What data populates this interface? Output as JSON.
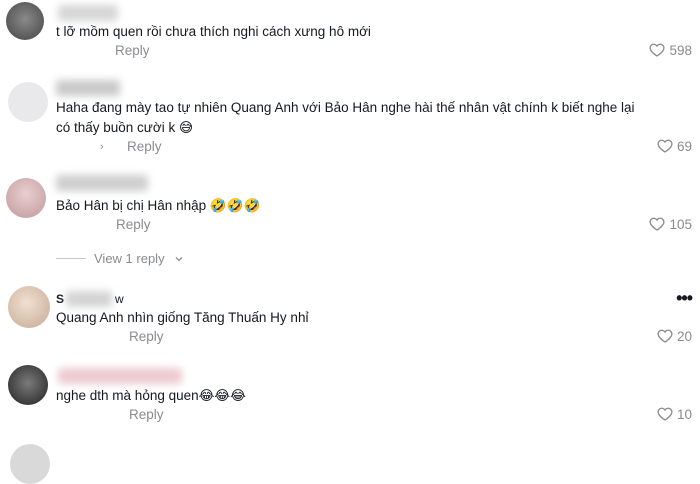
{
  "comments": [
    {
      "text": "t lỡ mồm quen rồi chưa thích nghi cách xưng hô mới",
      "reply_label": "Reply",
      "likes": "598",
      "avatar_color": "#6e6e6e"
    },
    {
      "text": "Haha đang mày tao tự nhiên Quang Anh với Bảo Hân nghe hài thế nhân vật chính k biết nghe lại có thấy buồn cười k 😅",
      "reply_label": "Reply",
      "likes": "69",
      "avatar_color": "#e9e9ec"
    },
    {
      "text": "Bảo Hân bị chị Hân nhập 🤣🤣🤣",
      "reply_label": "Reply",
      "likes": "105",
      "avatar_color": "#d8b8bb",
      "view_replies_label": "View 1 reply"
    },
    {
      "text": "Quang Anh nhìn giống Tăng Thuấn Hy nhỉ",
      "reply_label": "Reply",
      "likes": "20",
      "avatar_color": "#e7d4c6",
      "name_initial": "S",
      "name_tail": "w"
    },
    {
      "text": "nghe dth mà hỏng quen😂😂😂",
      "reply_label": "Reply",
      "likes": "10",
      "avatar_color": "#4a4a4a"
    }
  ],
  "colors": {
    "text": "#161823",
    "muted": "#8a8b91",
    "background": "#ffffff"
  },
  "icons": {
    "like": "heart-outline-icon",
    "more": "more-dots-icon",
    "expand": "chevron-down-icon"
  }
}
